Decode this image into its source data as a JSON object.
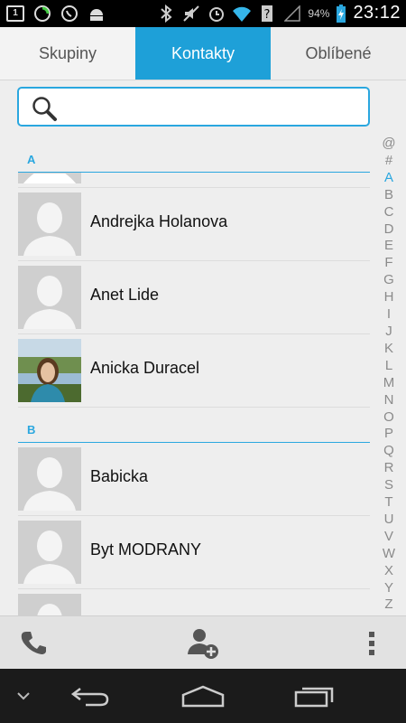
{
  "status_bar": {
    "notification_count": "1",
    "battery_percent": "94%",
    "time": "23:12",
    "icons": [
      "notification-count-icon",
      "sync-icon",
      "whatsapp-icon",
      "android-icon",
      "bluetooth-icon",
      "mute-icon",
      "alarm-icon",
      "wifi-icon",
      "question-icon",
      "signal-icon",
      "battery-charging-icon"
    ]
  },
  "tabs": [
    {
      "label": "Skupiny"
    },
    {
      "label": "Kontakty"
    },
    {
      "label": "Oblíbené"
    }
  ],
  "search": {
    "value": "",
    "placeholder": ""
  },
  "sections": [
    {
      "letter": "A",
      "contacts": [
        {
          "name": "Andrejka Holanova",
          "avatar": "default"
        },
        {
          "name": "Anet Lide",
          "avatar": "default"
        },
        {
          "name": "Anicka Duracel",
          "avatar": "photo"
        }
      ]
    },
    {
      "letter": "B",
      "contacts": [
        {
          "name": "Babicka",
          "avatar": "default"
        },
        {
          "name": "Byt MODRANY",
          "avatar": "default"
        }
      ]
    }
  ],
  "alphabet_index": {
    "letters": [
      "@",
      "#",
      "A",
      "B",
      "C",
      "D",
      "E",
      "F",
      "G",
      "H",
      "I",
      "J",
      "K",
      "L",
      "M",
      "N",
      "O",
      "P",
      "Q",
      "R",
      "S",
      "T",
      "U",
      "V",
      "W",
      "X",
      "Y",
      "Z"
    ],
    "active": "A"
  },
  "action_bar": {
    "icons": [
      "phone-icon",
      "add-contact-icon",
      "overflow-menu-icon"
    ]
  },
  "nav_bar": {
    "icons": [
      "hide-keyboard-icon",
      "back-icon",
      "home-icon",
      "recent-apps-icon"
    ]
  },
  "colors": {
    "accent": "#1ea0d8",
    "section": "#2aa7df"
  }
}
